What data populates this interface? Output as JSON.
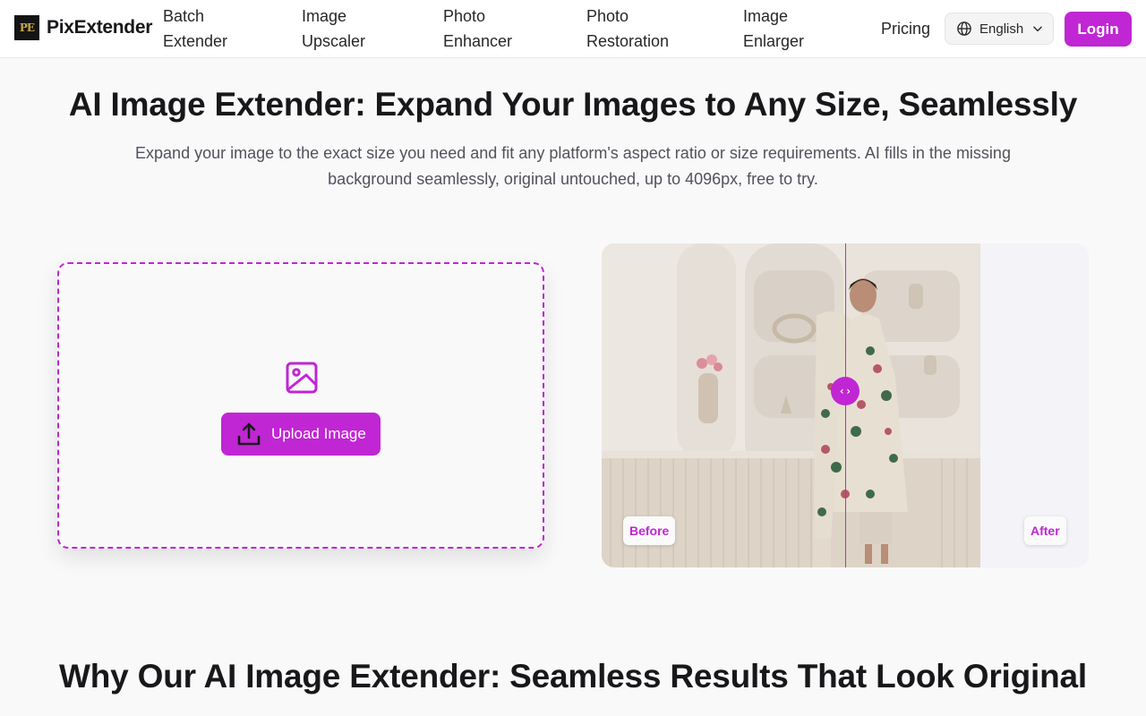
{
  "brand": {
    "name": "PixExtender",
    "logo_letters": "PE"
  },
  "nav": {
    "items": [
      {
        "line1": "Batch",
        "line2": "Extender"
      },
      {
        "line1": "Image",
        "line2": "Upscaler"
      },
      {
        "line1": "Photo",
        "line2": "Enhancer"
      },
      {
        "line1": "Photo",
        "line2": "Restoration"
      },
      {
        "line1": "Image",
        "line2": "Enlarger"
      }
    ],
    "pricing": "Pricing",
    "language": "English",
    "login": "Login"
  },
  "hero": {
    "title": "AI Image Extender: Expand Your Images to Any Size, Seamlessly",
    "subtitle": "Expand your image to the exact size you need and fit any platform's aspect ratio or size requirements. AI fills in the missing background seamlessly, original untouched, up to 4096px, free to try."
  },
  "upload": {
    "button_label": "Upload Image"
  },
  "compare": {
    "before_label": "Before",
    "after_label": "After",
    "handle_glyph": "‹›"
  },
  "section2": {
    "title": "Why Our AI Image Extender: Seamless Results That Look Original"
  },
  "colors": {
    "accent": "#c026d3",
    "text": "#18181b",
    "muted": "#52525b",
    "background": "#f9f9fa"
  }
}
